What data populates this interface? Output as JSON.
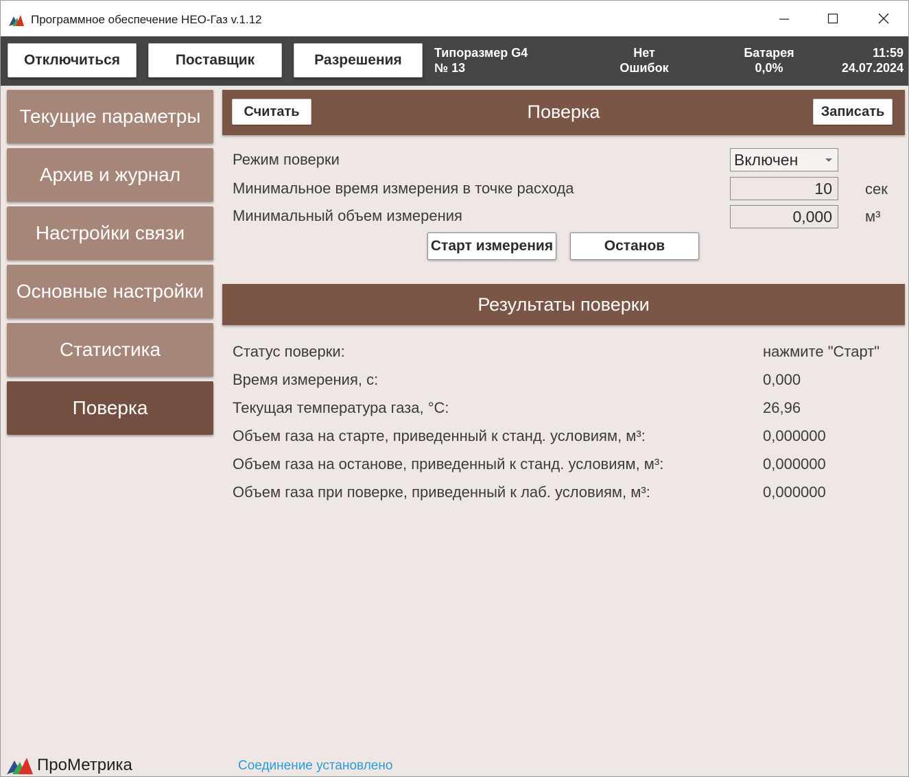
{
  "window": {
    "title": "Программное обеспечение НЕО-Газ v.1.12"
  },
  "toolbar": {
    "disconnect_label": "Отключиться",
    "supplier_label": "Поставщик",
    "permissions_label": "Разрешения",
    "size_line1": "Типоразмер G4",
    "size_line2": "№ 13",
    "errors_line1": "Нет",
    "errors_line2": "Ошибок",
    "battery_line1": "Батарея",
    "battery_line2": "0,0%",
    "time": "11:59",
    "date": "24.07.2024"
  },
  "sidebar": {
    "items": [
      {
        "label": "Текущие параметры",
        "active": false
      },
      {
        "label": "Архив и журнал",
        "active": false
      },
      {
        "label": "Настройки связи",
        "active": false
      },
      {
        "label": "Основные настройки",
        "active": false
      },
      {
        "label": "Статистика",
        "active": false
      },
      {
        "label": "Поверка",
        "active": true
      }
    ]
  },
  "verification": {
    "read_label": "Считать",
    "title": "Поверка",
    "write_label": "Записать",
    "mode_label": "Режим поверки",
    "mode_value": "Включен",
    "min_time_label": "Минимальное время измерения в точке расхода",
    "min_time_value": "10",
    "min_time_unit": "сек",
    "min_volume_label": "Минимальный объем измерения",
    "min_volume_value": "0,000",
    "min_volume_unit": "м³",
    "start_label": "Старт измерения",
    "stop_label": "Останов"
  },
  "results": {
    "title": "Результаты поверки",
    "rows": [
      {
        "label": "Статус поверки:",
        "value": "нажмите \"Старт\""
      },
      {
        "label": "Время измерения, с:",
        "value": "0,000"
      },
      {
        "label": "Текущая температура газа, °C:",
        "value": "26,96"
      },
      {
        "label": "Объем газа на старте, приведенный к станд. условиям, м³:",
        "value": "0,000000"
      },
      {
        "label": "Объем газа на останове, приведенный к станд. условиям, м³:",
        "value": "0,000000"
      },
      {
        "label": "Объем газа при поверке, приведенный к лаб. условиям, м³:",
        "value": "0,000000"
      }
    ]
  },
  "footer": {
    "logo_text": "ПроМетрика",
    "connection_status": "Соединение установлено"
  },
  "colors": {
    "nav_inactive": "#a7867a",
    "nav_active": "#734f41",
    "section_header": "#7b5646",
    "toolbar": "#454545",
    "status_link": "#2a9cd8"
  }
}
